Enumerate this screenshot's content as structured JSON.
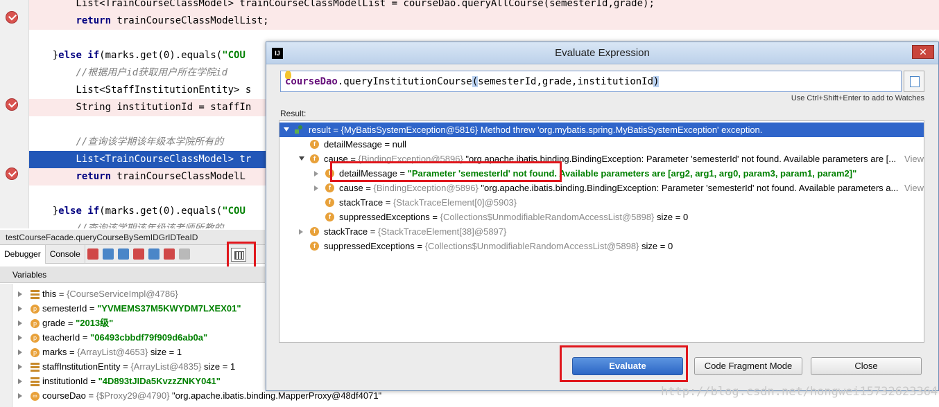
{
  "editor": {
    "lines": [
      {
        "id": "l0",
        "html_parts": [
          {
            "t": "        List<TrainCourseClassModel> trainCourseClassModelList = courseDao.queryAllCourse(semesterId,grade);",
            "c": ""
          }
        ]
      },
      {
        "id": "l1",
        "html_parts": [
          {
            "t": "        ",
            "c": ""
          },
          {
            "t": "return",
            "c": "kw"
          },
          {
            "t": " trainCourseClassModelList;",
            "c": ""
          }
        ]
      },
      {
        "id": "l2",
        "html_parts": [
          {
            "t": "",
            "c": ""
          }
        ]
      },
      {
        "id": "l3",
        "html_parts": [
          {
            "t": "    }",
            "c": ""
          },
          {
            "t": "else if",
            "c": "kw"
          },
          {
            "t": "(marks.get(0).equals(",
            "c": ""
          },
          {
            "t": "\"COU",
            "c": "str"
          }
        ]
      },
      {
        "id": "l4",
        "html_parts": [
          {
            "t": "        ",
            "c": ""
          },
          {
            "t": "//根据用户id获取用户所在学院id",
            "c": "cm"
          }
        ]
      },
      {
        "id": "l5",
        "html_parts": [
          {
            "t": "        List<StaffInstitutionEntity> s",
            "c": ""
          }
        ]
      },
      {
        "id": "l6",
        "html_parts": [
          {
            "t": "        String institutionId = staffIn",
            "c": ""
          }
        ]
      },
      {
        "id": "l7",
        "html_parts": [
          {
            "t": "",
            "c": ""
          }
        ]
      },
      {
        "id": "l8",
        "html_parts": [
          {
            "t": "        ",
            "c": ""
          },
          {
            "t": "//查询该学期该年级本学院所有的",
            "c": "cm"
          }
        ]
      },
      {
        "id": "l9",
        "html_parts": [
          {
            "t": "        List<TrainCourseClassModel> tr",
            "c": ""
          }
        ]
      },
      {
        "id": "l10",
        "html_parts": [
          {
            "t": "        ",
            "c": ""
          },
          {
            "t": "return",
            "c": "kw"
          },
          {
            "t": " trainCourseClassModelL",
            "c": ""
          }
        ]
      },
      {
        "id": "l11",
        "html_parts": [
          {
            "t": "",
            "c": ""
          }
        ]
      },
      {
        "id": "l12",
        "html_parts": [
          {
            "t": "    }",
            "c": ""
          },
          {
            "t": "else if",
            "c": "kw"
          },
          {
            "t": "(marks.get(0).equals(",
            "c": ""
          },
          {
            "t": "\"COU",
            "c": "str"
          }
        ]
      },
      {
        "id": "l13",
        "html_parts": [
          {
            "t": "        ",
            "c": ""
          },
          {
            "t": "//查询该学期该年级该老师所教的",
            "c": "cm"
          }
        ]
      }
    ]
  },
  "frame": {
    "label": "testCourseFacade.queryCourseBySemIDGrIDTeaID"
  },
  "debug_tabs": {
    "debugger": "Debugger",
    "console": "Console"
  },
  "variables": {
    "header": "Variables",
    "rows": [
      {
        "icon": "bars",
        "name": "this",
        "eq": " = ",
        "grey": "{CourseServiceImpl@4786}",
        "val": "",
        "strval": ""
      },
      {
        "icon": "p",
        "name": "semesterId",
        "eq": " = ",
        "grey": "",
        "val": "",
        "strval": "\"YVMEMS37M5KWYDM7LXEX01\""
      },
      {
        "icon": "p",
        "name": "grade",
        "eq": " = ",
        "grey": "",
        "val": "",
        "strval": "\"2013级\""
      },
      {
        "icon": "p",
        "name": "teacherId",
        "eq": " = ",
        "grey": "",
        "val": "",
        "strval": "\"06493cbbdf79f909d6ab0a\""
      },
      {
        "icon": "p",
        "name": "marks",
        "eq": " = ",
        "grey": "{ArrayList@4653}",
        "val": "  size = 1",
        "strval": ""
      },
      {
        "icon": "bars",
        "name": "staffInstitutionEntity",
        "eq": " = ",
        "grey": "{ArrayList@4835}",
        "val": "  size = 1",
        "strval": ""
      },
      {
        "icon": "bars",
        "name": "institutionId",
        "eq": " = ",
        "grey": "",
        "val": "",
        "strval": "\"4D893tJIDa5KvzzZNKY041\""
      },
      {
        "icon": "oo",
        "name": "courseDao",
        "eq": " = ",
        "grey": "{$Proxy29@4790}",
        "val": " \"org.apache.ibatis.binding.MapperProxy@48df4071\"",
        "strval": ""
      }
    ]
  },
  "dialog": {
    "title": "Evaluate Expression",
    "close": "✕",
    "expression": {
      "obj": "courseDao",
      "mid": ".queryInstitutionCourse",
      "open": "(",
      "args": "semesterId,grade,institutionId",
      "close": ")"
    },
    "hint": "Use Ctrl+Shift+Enter to add to Watches",
    "result_label": "Result:",
    "tree": [
      {
        "id": "t0",
        "depth": 0,
        "arrow": "down",
        "icon": "r",
        "name": "result",
        "eq": " = ",
        "grey": "{MyBatisSystemException@5816}",
        "rest": " Method threw 'org.mybatis.spring.MyBatisSystemException' exception.",
        "str": "",
        "view": "",
        "sel": true
      },
      {
        "id": "t1",
        "depth": 1,
        "arrow": "",
        "icon": "f",
        "name": "detailMessage",
        "eq": " = ",
        "grey": "",
        "rest": "null",
        "str": "",
        "view": ""
      },
      {
        "id": "t2",
        "depth": 1,
        "arrow": "down",
        "icon": "f",
        "name": "cause",
        "eq": " = ",
        "grey": "{BindingException@5896}",
        "rest": " \"org.apache.ibatis.binding.BindingException: Parameter 'semesterId' not found. Available parameters are [...",
        "str": "",
        "view": "View"
      },
      {
        "id": "t3",
        "depth": 2,
        "arrow": "right",
        "icon": "f",
        "name": "detailMessage",
        "eq": " = ",
        "grey": "",
        "rest": "",
        "str": "\"Parameter 'semesterId' not found. Available parameters are [arg2, arg1, arg0, param3, param1, param2]\"",
        "view": ""
      },
      {
        "id": "t4",
        "depth": 2,
        "arrow": "right",
        "icon": "f",
        "name": "cause",
        "eq": " = ",
        "grey": "{BindingException@5896}",
        "rest": " \"org.apache.ibatis.binding.BindingException: Parameter 'semesterId' not found. Available parameters a...",
        "str": "",
        "view": "View"
      },
      {
        "id": "t5",
        "depth": 2,
        "arrow": "",
        "icon": "f",
        "name": "stackTrace",
        "eq": " = ",
        "grey": "{StackTraceElement[0]@5903}",
        "rest": "",
        "str": "",
        "view": ""
      },
      {
        "id": "t6",
        "depth": 2,
        "arrow": "",
        "icon": "f",
        "name": "suppressedExceptions",
        "eq": " = ",
        "grey": "{Collections$UnmodifiableRandomAccessList@5898}",
        "rest": "  size = 0",
        "str": "",
        "view": ""
      },
      {
        "id": "t7",
        "depth": 1,
        "arrow": "right",
        "icon": "f",
        "name": "stackTrace",
        "eq": " = ",
        "grey": "{StackTraceElement[38]@5897}",
        "rest": "",
        "str": "",
        "view": ""
      },
      {
        "id": "t8",
        "depth": 1,
        "arrow": "",
        "icon": "f",
        "name": "suppressedExceptions",
        "eq": " = ",
        "grey": "{Collections$UnmodifiableRandomAccessList@5898}",
        "rest": "  size = 0",
        "str": "",
        "view": ""
      }
    ],
    "buttons": {
      "evaluate": "Evaluate",
      "fragment": "Code Fragment Mode",
      "close": "Close"
    }
  },
  "watermark": "http://blog.csdn.net/hongwei15732623364",
  "colors": {
    "accent": "#2f65ca",
    "highlight_box": "#e0161c",
    "string": "#008000"
  }
}
